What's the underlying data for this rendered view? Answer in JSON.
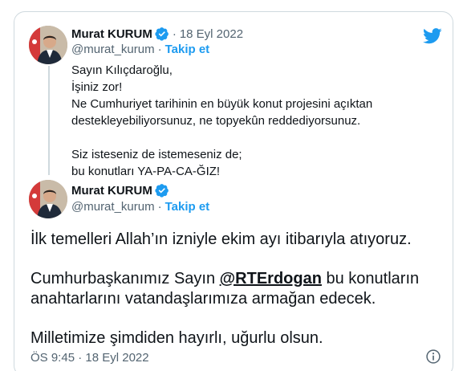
{
  "quoted_tweet": {
    "author_name": "Murat KURUM",
    "separator": "·",
    "date": "18 Eyl 2022",
    "handle": "@murat_kurum",
    "handle_separator": "·",
    "follow_label": "Takip et",
    "lines": [
      "Sayın Kılıçdaroğlu,",
      "İşiniz zor!",
      "Ne Cumhuriyet tarihinin en büyük konut projesini açıktan",
      "destekleyebiliyorsunuz, ne topyekûn reddediyorsunuz.",
      "",
      "Siz isteseniz de istemeseniz de;",
      "bu konutları YA-PA-CA-ĞIZ!"
    ]
  },
  "main_tweet": {
    "author_name": "Murat KURUM",
    "handle": "@murat_kurum",
    "handle_separator": "·",
    "follow_label": "Takip et",
    "paragraph1": "İlk temelleri Allah’ın izniyle ekim ayı itibarıyla atıyoruz.",
    "paragraph2_before": "Cumhurbaşkanımız Sayın ",
    "mention": "@RTErdogan",
    "paragraph2_after": " bu konutların anahtarlarını vatandaşlarımıza armağan edecek.",
    "paragraph3": "Milletimize şimdiden hayırlı, uğurlu olsun.",
    "timestamp": "ÖS 9:45 · 18 Eyl 2022"
  },
  "icons": {
    "brand": "twitter-bird-icon",
    "verified": "verified-badge-icon",
    "info": "info-icon"
  },
  "colors": {
    "accent": "#1d9bf0",
    "text": "#0f1419",
    "secondary": "#536471",
    "border": "#cfd9de"
  }
}
